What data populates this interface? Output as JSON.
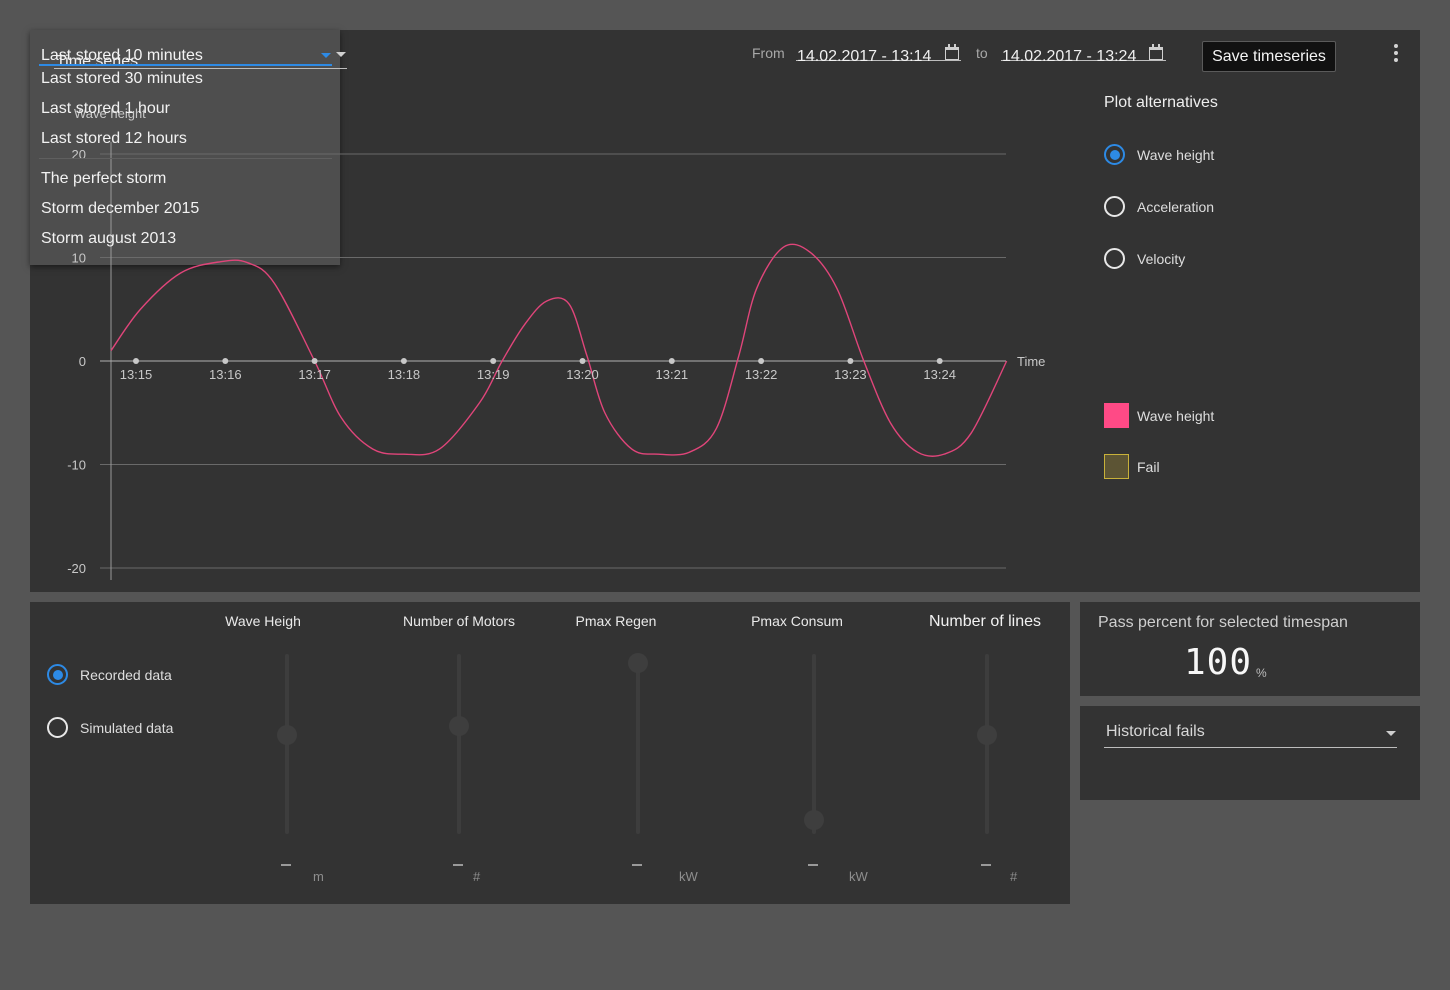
{
  "header": {
    "series_select": "Time series",
    "range_select": {
      "selected": "Last stored 10 minutes",
      "options_recent": [
        "Last stored 30 minutes",
        "Last stored 1 hour",
        "Last stored 12 hours"
      ],
      "options_storms": [
        "The perfect storm",
        "Storm december 2015",
        "Storm august 2013"
      ]
    },
    "from_label": "From",
    "from_value": "14.02.2017 - 13:14",
    "to_label": "to",
    "to_value": "14.02.2017 - 13:24",
    "save_label": "Save timeseries"
  },
  "chart_data": {
    "type": "line",
    "ylabel": "Wave height",
    "xlabel": "Time",
    "ylim": [
      -20,
      20
    ],
    "yticks": [
      20,
      10,
      0,
      -10,
      -20
    ],
    "xticks": [
      "13:15",
      "13:16",
      "13:17",
      "13:18",
      "13:19",
      "13:20",
      "13:21",
      "13:22",
      "13:23",
      "13:24"
    ],
    "grid": true,
    "series": [
      {
        "name": "Wave height",
        "color": "#e0457a",
        "x_min": [
          -0.28,
          0.05,
          0.5,
          0.95,
          1.25,
          1.55,
          2.0,
          2.3,
          2.65,
          3.0,
          3.4,
          3.85,
          4.1,
          4.35,
          4.6,
          4.85,
          5.05,
          5.25,
          5.55,
          5.85,
          6.2,
          6.5,
          6.75,
          6.95,
          7.25,
          7.55,
          7.85,
          8.15,
          8.45,
          8.75,
          9.05,
          9.35,
          9.75
        ],
        "y": [
          1,
          5,
          8.5,
          9.6,
          9.5,
          7.5,
          0,
          -5.5,
          -8.5,
          -9,
          -8.5,
          -4,
          0,
          3.5,
          5.8,
          5.5,
          0.5,
          -5,
          -8.5,
          -9,
          -8.8,
          -6.5,
          0.5,
          7,
          11,
          10.5,
          7,
          0,
          -6,
          -8.8,
          -9,
          -7,
          0
        ]
      }
    ]
  },
  "plot_alternatives": {
    "title": "Plot alternatives",
    "options": [
      "Wave height",
      "Acceleration",
      "Velocity"
    ],
    "selected": 0
  },
  "legend": [
    {
      "label": "Wave height",
      "color": "#ff4a86"
    },
    {
      "label": "Fail",
      "color": "#5c5434"
    }
  ],
  "data_source": {
    "options": [
      "Recorded data",
      "Simulated data"
    ],
    "selected": 0
  },
  "sliders": [
    {
      "title": "Wave Heigh",
      "unit": "m",
      "value": "–",
      "level": 0.55
    },
    {
      "title": "Number of Motors",
      "unit": "#",
      "value": "–",
      "level": 0.6
    },
    {
      "title": "Pmax Regen",
      "unit": "kW",
      "value": "–",
      "level": 0.95
    },
    {
      "title": "Pmax Consum",
      "unit": "kW",
      "value": "–",
      "level": 0.08
    },
    {
      "title": "Number of lines",
      "unit": "#",
      "value": "–",
      "level": 0.55
    }
  ],
  "pass": {
    "title": "Pass percent for selected timespan",
    "value": "100",
    "unit": "%"
  },
  "fails": {
    "select": "Historical fails"
  },
  "colors": {
    "accent": "#2d8ae5",
    "panel": "#333333",
    "background": "#555555"
  }
}
